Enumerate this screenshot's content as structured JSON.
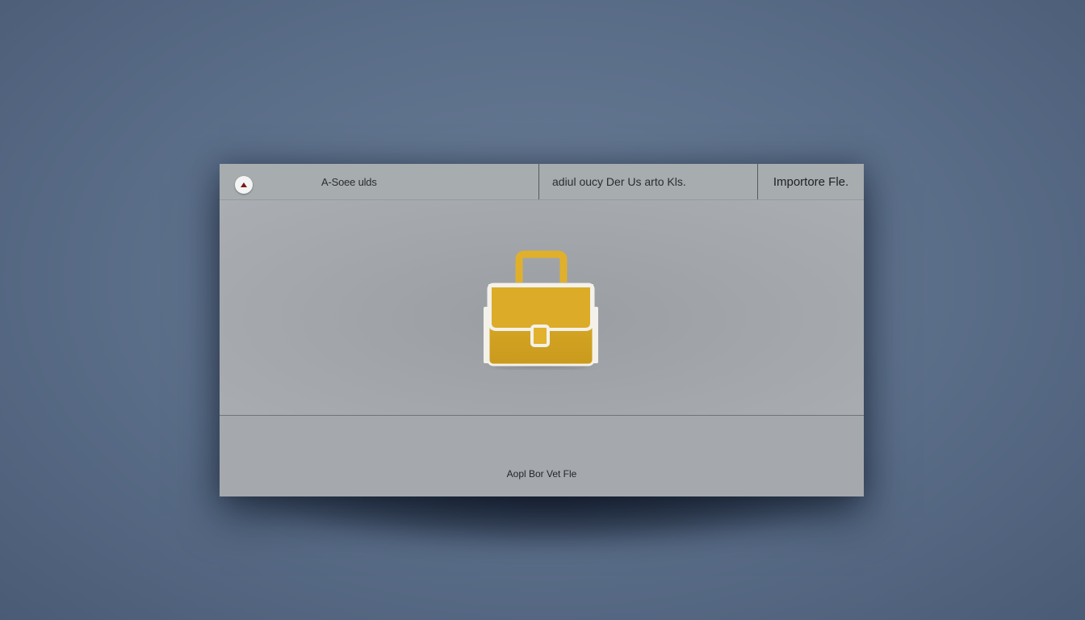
{
  "toolbar": {
    "back_icon": "caret-up-icon",
    "left_label": "A-Soee ulds",
    "middle_label": "adiul oucy Der Us arto Kls.",
    "right_label": "Importore Fle."
  },
  "main": {
    "icon": "briefcase-icon",
    "icon_color": "#D8A826"
  },
  "footer": {
    "label": "Aopl Bor Vet Fle"
  }
}
